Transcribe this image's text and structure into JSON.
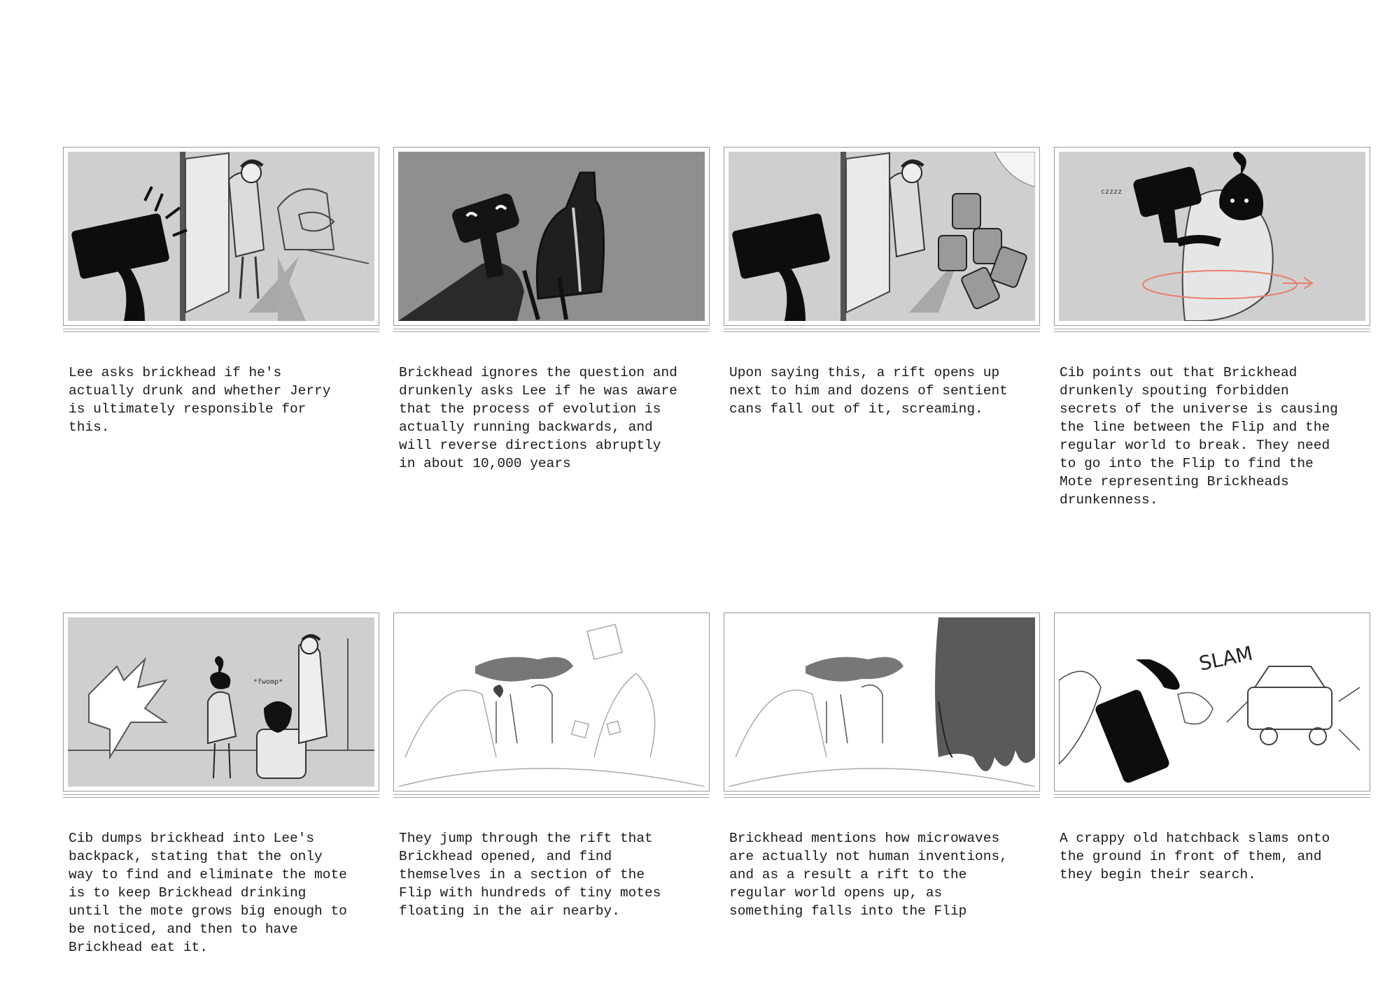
{
  "panels": [
    {
      "caption": "Lee asks brickhead if he's\nactually drunk and whether Jerry\nis ultimately responsible for\nthis."
    },
    {
      "caption": "Brickhead ignores the question and\ndrunkenly asks Lee if he was aware\nthat the process of evolution is\nactually running backwards, and\nwill reverse directions abruptly\nin about 10,000 years"
    },
    {
      "caption": "Upon saying this, a rift opens up\nnext to him and dozens of sentient\ncans fall out of it, screaming."
    },
    {
      "caption": "Cib points out that Brickhead\ndrunkenly spouting forbidden\nsecrets of the universe is causing\nthe line between the Flip and the\nregular world to break. They need\nto go into the Flip to find the\nMote representing Brickheads\ndrunkenness."
    },
    {
      "caption": "Cib dumps brickhead into Lee's\nbackpack, stating that the only\nway to find and eliminate the mote\nis to keep Brickhead drinking\nuntil the mote grows big enough to\nbe noticed, and then to have\nBrickhead eat it."
    },
    {
      "caption": "They jump through the rift that\nBrickhead opened, and find\nthemselves in a section of the\nFlip with hundreds of tiny motes\nfloating in the air nearby."
    },
    {
      "caption": "Brickhead mentions how microwaves\nare actually not human inventions,\nand as a result a rift to the\nregular world opens up, as\nsomething falls into the Flip"
    },
    {
      "caption": "A crappy old hatchback slams onto\nthe ground in front of them, and\nthey begin their search."
    }
  ],
  "sketch_text": {
    "slam": "SLAM",
    "whomp": "*fwomp*",
    "snore": "czzzz"
  },
  "colors": {
    "sketch_gray": "#cfcfcf",
    "sketch_dark_gray": "#8f8f8f",
    "ink": "#111111",
    "arrow": "#e8806a"
  }
}
